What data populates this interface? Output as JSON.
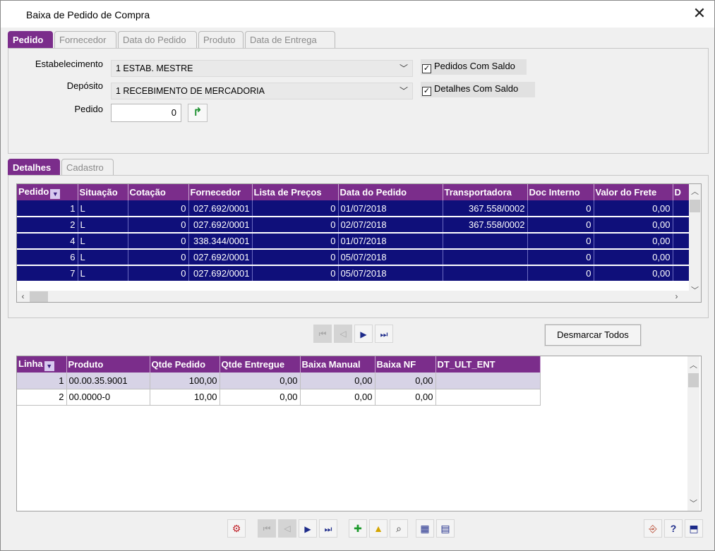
{
  "window": {
    "title": "Baixa de Pedido de Compra"
  },
  "top_tabs": [
    "Pedido",
    "Fornecedor",
    "Data do Pedido",
    "Produto",
    "Data de Entrega"
  ],
  "form": {
    "estabelecimento_label": "Estabelecimento",
    "estabelecimento_value": "1 ESTAB. MESTRE",
    "deposito_label": "Depósito",
    "deposito_value": "1 RECEBIMENTO DE MERCADORIA",
    "pedido_label": "Pedido",
    "pedido_value": "0",
    "chk_pedidos_saldo": "Pedidos Com Saldo",
    "chk_detalhes_saldo": "Detalhes Com Saldo"
  },
  "detail_tabs": [
    "Detalhes",
    "Cadastro"
  ],
  "orders": {
    "columns": [
      "Pedido",
      "Situação",
      "Cotação",
      "Fornecedor",
      "Lista de Preços",
      "Data do Pedido",
      "Transportadora",
      "Doc Interno",
      "Valor do Frete",
      "D"
    ],
    "rows": [
      [
        "1",
        "L",
        "0",
        "027.692/0001",
        "0",
        "01/07/2018",
        "367.558/0002",
        "0",
        "0,00"
      ],
      [
        "2",
        "L",
        "0",
        "027.692/0001",
        "0",
        "02/07/2018",
        "367.558/0002",
        "0",
        "0,00"
      ],
      [
        "4",
        "L",
        "0",
        "338.344/0001",
        "0",
        "01/07/2018",
        "",
        "0",
        "0,00"
      ],
      [
        "6",
        "L",
        "0",
        "027.692/0001",
        "0",
        "05/07/2018",
        "",
        "0",
        "0,00"
      ],
      [
        "7",
        "L",
        "0",
        "027.692/0001",
        "0",
        "05/07/2018",
        "",
        "0",
        "0,00"
      ]
    ]
  },
  "desmarcar_label": "Desmarcar Todos",
  "items": {
    "columns": [
      "Linha",
      "Produto",
      "Qtde Pedido",
      "Qtde Entregue",
      "Baixa Manual",
      "Baixa NF",
      "DT_ULT_ENT"
    ],
    "rows": [
      [
        "1",
        "00.00.35.9001",
        "100,00",
        "0,00",
        "0,00",
        "0,00",
        ""
      ],
      [
        "2",
        "00.0000-0",
        "10,00",
        "0,00",
        "0,00",
        "0,00",
        ""
      ]
    ]
  }
}
